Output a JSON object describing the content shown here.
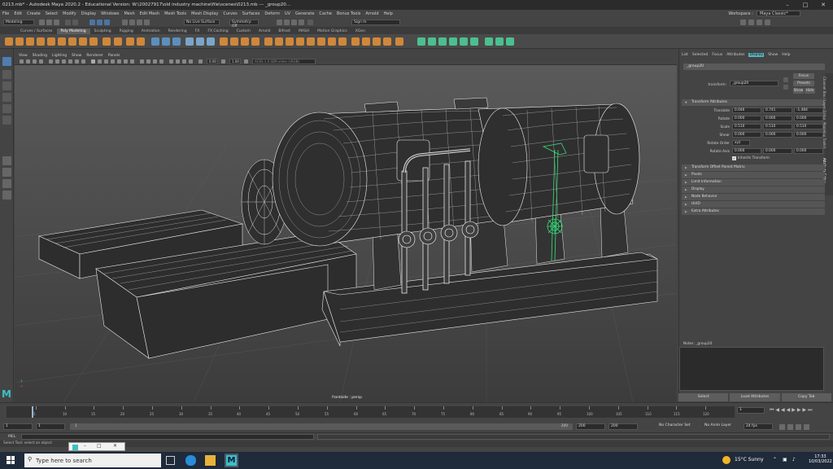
{
  "window": {
    "title": "0213.mb* - Autodesk Maya 2020.2 - Educational Version: W:\\20027917\\old industry machine\\file\\scenes\\0213.mb   ---   _group20..."
  },
  "menubar": {
    "items": [
      "File",
      "Edit",
      "Create",
      "Select",
      "Modify",
      "Display",
      "Windows",
      "Mesh",
      "Edit Mesh",
      "Mesh Tools",
      "Mesh Display",
      "Curves",
      "Surfaces",
      "Deform",
      "UV",
      "Generate",
      "Cache",
      "Bonus Tools",
      "Arnold",
      "Help"
    ],
    "workspace_label": "Workspace :",
    "workspace_value": "Maya Classic*"
  },
  "statusline": {
    "mode": "Modeling",
    "live_surface": "No Live Surface",
    "symmetry": "Symmetry: Off",
    "signin": "Sign In"
  },
  "shelf": {
    "tabs": [
      "Curves / Surfaces",
      "Poly Modeling",
      "Sculpting",
      "Rigging",
      "Animation",
      "Rendering",
      "FX",
      "FX Caching",
      "Custom",
      "Arnold",
      "Bifrost",
      "MASH",
      "Motion Graphics",
      "XGen"
    ],
    "active_tab": "Poly Modeling"
  },
  "panel": {
    "menus": [
      "View",
      "Shading",
      "Lighting",
      "Show",
      "Renderer",
      "Panels"
    ],
    "field_a": "0.00",
    "field_b": "1.00",
    "color_space": "ACES 1.0 SDR-video (sRGB)",
    "camera_label": "frontside : persp"
  },
  "attribute_editor": {
    "menus": [
      "List",
      "Selected",
      "Focus",
      "Attributes",
      "Display",
      "Show",
      "Help"
    ],
    "highlight_menu": "Display",
    "node_tab": "_group20",
    "transform_label": "transform:",
    "transform_value": "_group20",
    "focus_btn": "Focus",
    "presets_btn": "Presets",
    "show_btn": "Show",
    "hide_btn": "Hide",
    "transform_attrs_header": "Transform Attributes",
    "rows": [
      {
        "label": "Translate",
        "values": [
          "0.046",
          "0.741",
          "-1.484"
        ]
      },
      {
        "label": "Rotate",
        "values": [
          "0.000",
          "0.000",
          "0.000"
        ]
      },
      {
        "label": "Scale",
        "values": [
          "0.510",
          "0.510",
          "0.510"
        ]
      },
      {
        "label": "Shear",
        "values": [
          "0.000",
          "0.000",
          "0.000"
        ]
      }
    ],
    "rotate_order_label": "Rotate Order",
    "rotate_order_value": "xyz",
    "rotate_axis_label": "Rotate Axis",
    "rotate_axis_values": [
      "0.000",
      "0.000",
      "0.000"
    ],
    "inherits_transform": "Inherits Transform",
    "sections": [
      "Transform Offset Parent Matrix",
      "Pivots",
      "Limit Information",
      "Display",
      "Node Behavior",
      "UUID",
      "Extra Attributes"
    ],
    "notes_label": "Notes:  _group20",
    "vertical_tabs": [
      "Channel Box / Layer Editor",
      "Modeling Toolkit",
      "Attribute Editor"
    ],
    "bottom_buttons": [
      "Select",
      "Load Attributes",
      "Copy Tab"
    ]
  },
  "timeslider": {
    "ticks": [
      "5",
      "10",
      "15",
      "20",
      "25",
      "30",
      "35",
      "40",
      "45",
      "50",
      "55",
      "60",
      "65",
      "70",
      "75",
      "80",
      "85",
      "90",
      "95",
      "100",
      "105",
      "110",
      "115",
      "120"
    ],
    "current": "1"
  },
  "rangeslider": {
    "start": "1",
    "playback_start": "1",
    "range_start": "1",
    "range_end": "200",
    "playback_end": "200",
    "end": "200",
    "character_set": "No Character Set",
    "anim_layer": "No Anim Layer",
    "fps": "24 fps"
  },
  "cmdline": {
    "label": "MEL"
  },
  "helpline": {
    "text": "Select Tool: select an object"
  },
  "taskbar": {
    "search_placeholder": "Type here to search",
    "weather": "15°C  Sunny",
    "time": "17:33",
    "date": "10/03/2022"
  },
  "colors": {
    "selection_green": "#34e07a",
    "wire_white": "#f0f0f0",
    "viewport_top": "#565656",
    "viewport_bottom": "#3e3e3e",
    "highlight_blue": "#5bb4c1"
  }
}
